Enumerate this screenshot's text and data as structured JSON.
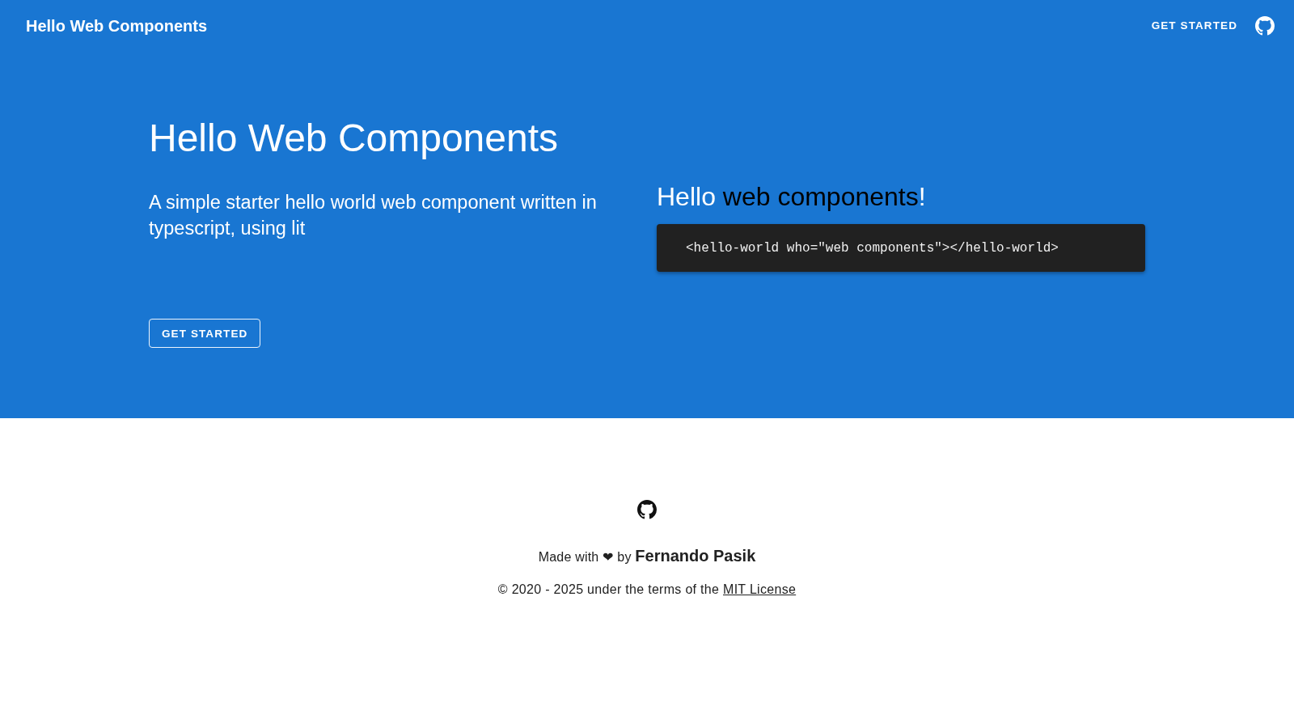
{
  "header": {
    "title": "Hello Web Components",
    "nav_link": "GET STARTED"
  },
  "hero": {
    "title": "Hello Web Components",
    "subtitle": "A simple starter hello world web component written in typescript, using lit",
    "button": "GET STARTED",
    "demo": {
      "greeting": "Hello",
      "who": "web components",
      "punctuation": "!",
      "code": "<hello-world who=\"web components\"></hello-world>"
    }
  },
  "footer": {
    "made_with": "Made with ❤ by",
    "author": "Fernando Pasik",
    "copyright": "© 2020 - 2025 under the terms of the",
    "license_link": "MIT License"
  }
}
